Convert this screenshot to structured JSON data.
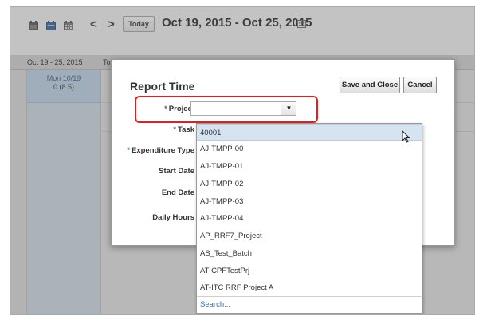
{
  "toolbar": {
    "today_label": "Today",
    "date_range": "Oct 19, 2015 - Oct 25, 2015",
    "icons": [
      "day-view-icon",
      "week-view-icon",
      "month-view-icon",
      "prev-chevron-icon",
      "next-chevron-icon",
      "calendar-picker-icon"
    ],
    "prev_glyph": "<",
    "next_glyph": ">"
  },
  "grid": {
    "range_label": "Oct 19 - 25, 2015",
    "total_label": "Tot",
    "day_name": "Mon 10/19",
    "day_hours": "0 (8.5)"
  },
  "dialog": {
    "title": "Report Time",
    "save_label": "Save and Close",
    "cancel_label": "Cancel",
    "required_mark": "*",
    "fields": {
      "project": "Project",
      "task": "Task",
      "expenditure": "Expenditure Type",
      "start_date": "Start Date",
      "end_date": "End Date",
      "daily_hours": "Daily Hours"
    },
    "project_value": ""
  },
  "dropdown": {
    "items": [
      "40001",
      "AJ-TMPP-00",
      "AJ-TMPP-01",
      "AJ-TMPP-02",
      "AJ-TMPP-03",
      "AJ-TMPP-04",
      "AP_RRF7_Project",
      "AS_Test_Batch",
      "AT-CPFTestPrj",
      "AT-ITC RRF Project A"
    ],
    "selected_index": 0,
    "search_label": "Search..."
  },
  "colors": {
    "highlight": "#e02020",
    "selected_item": "#d6e4f2",
    "link": "#2f6fb5",
    "day_column": "#cdd8e4"
  }
}
